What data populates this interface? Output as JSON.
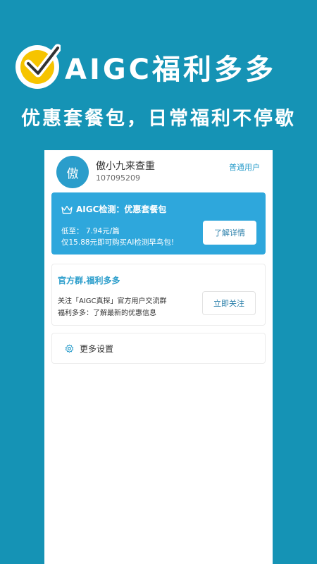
{
  "hero": {
    "title": "AIGC福利多多",
    "subtitle": "优惠套餐包，日常福利不停歇"
  },
  "profile": {
    "avatar_char": "傲",
    "name": "傲小九来查重",
    "id": "107095209",
    "level": "普通用户"
  },
  "promo": {
    "title": "AIGC检测：优惠套餐包",
    "price": "低至： 7.94元/篇",
    "description": "仅15.88元即可购买AI检测早鸟包!",
    "button_label": "了解详情"
  },
  "group": {
    "title": "官方群.福利多多",
    "line1": "关注「AIGC真探」官方用户交流群",
    "line2": "福利多多：了解最新的优惠信息",
    "button_label": "立即关注"
  },
  "settings": {
    "label": "更多设置",
    "icon": "gear-icon"
  },
  "colors": {
    "background": "#1593b5",
    "accent": "#2ea7dc",
    "badge": "#f6c400"
  }
}
